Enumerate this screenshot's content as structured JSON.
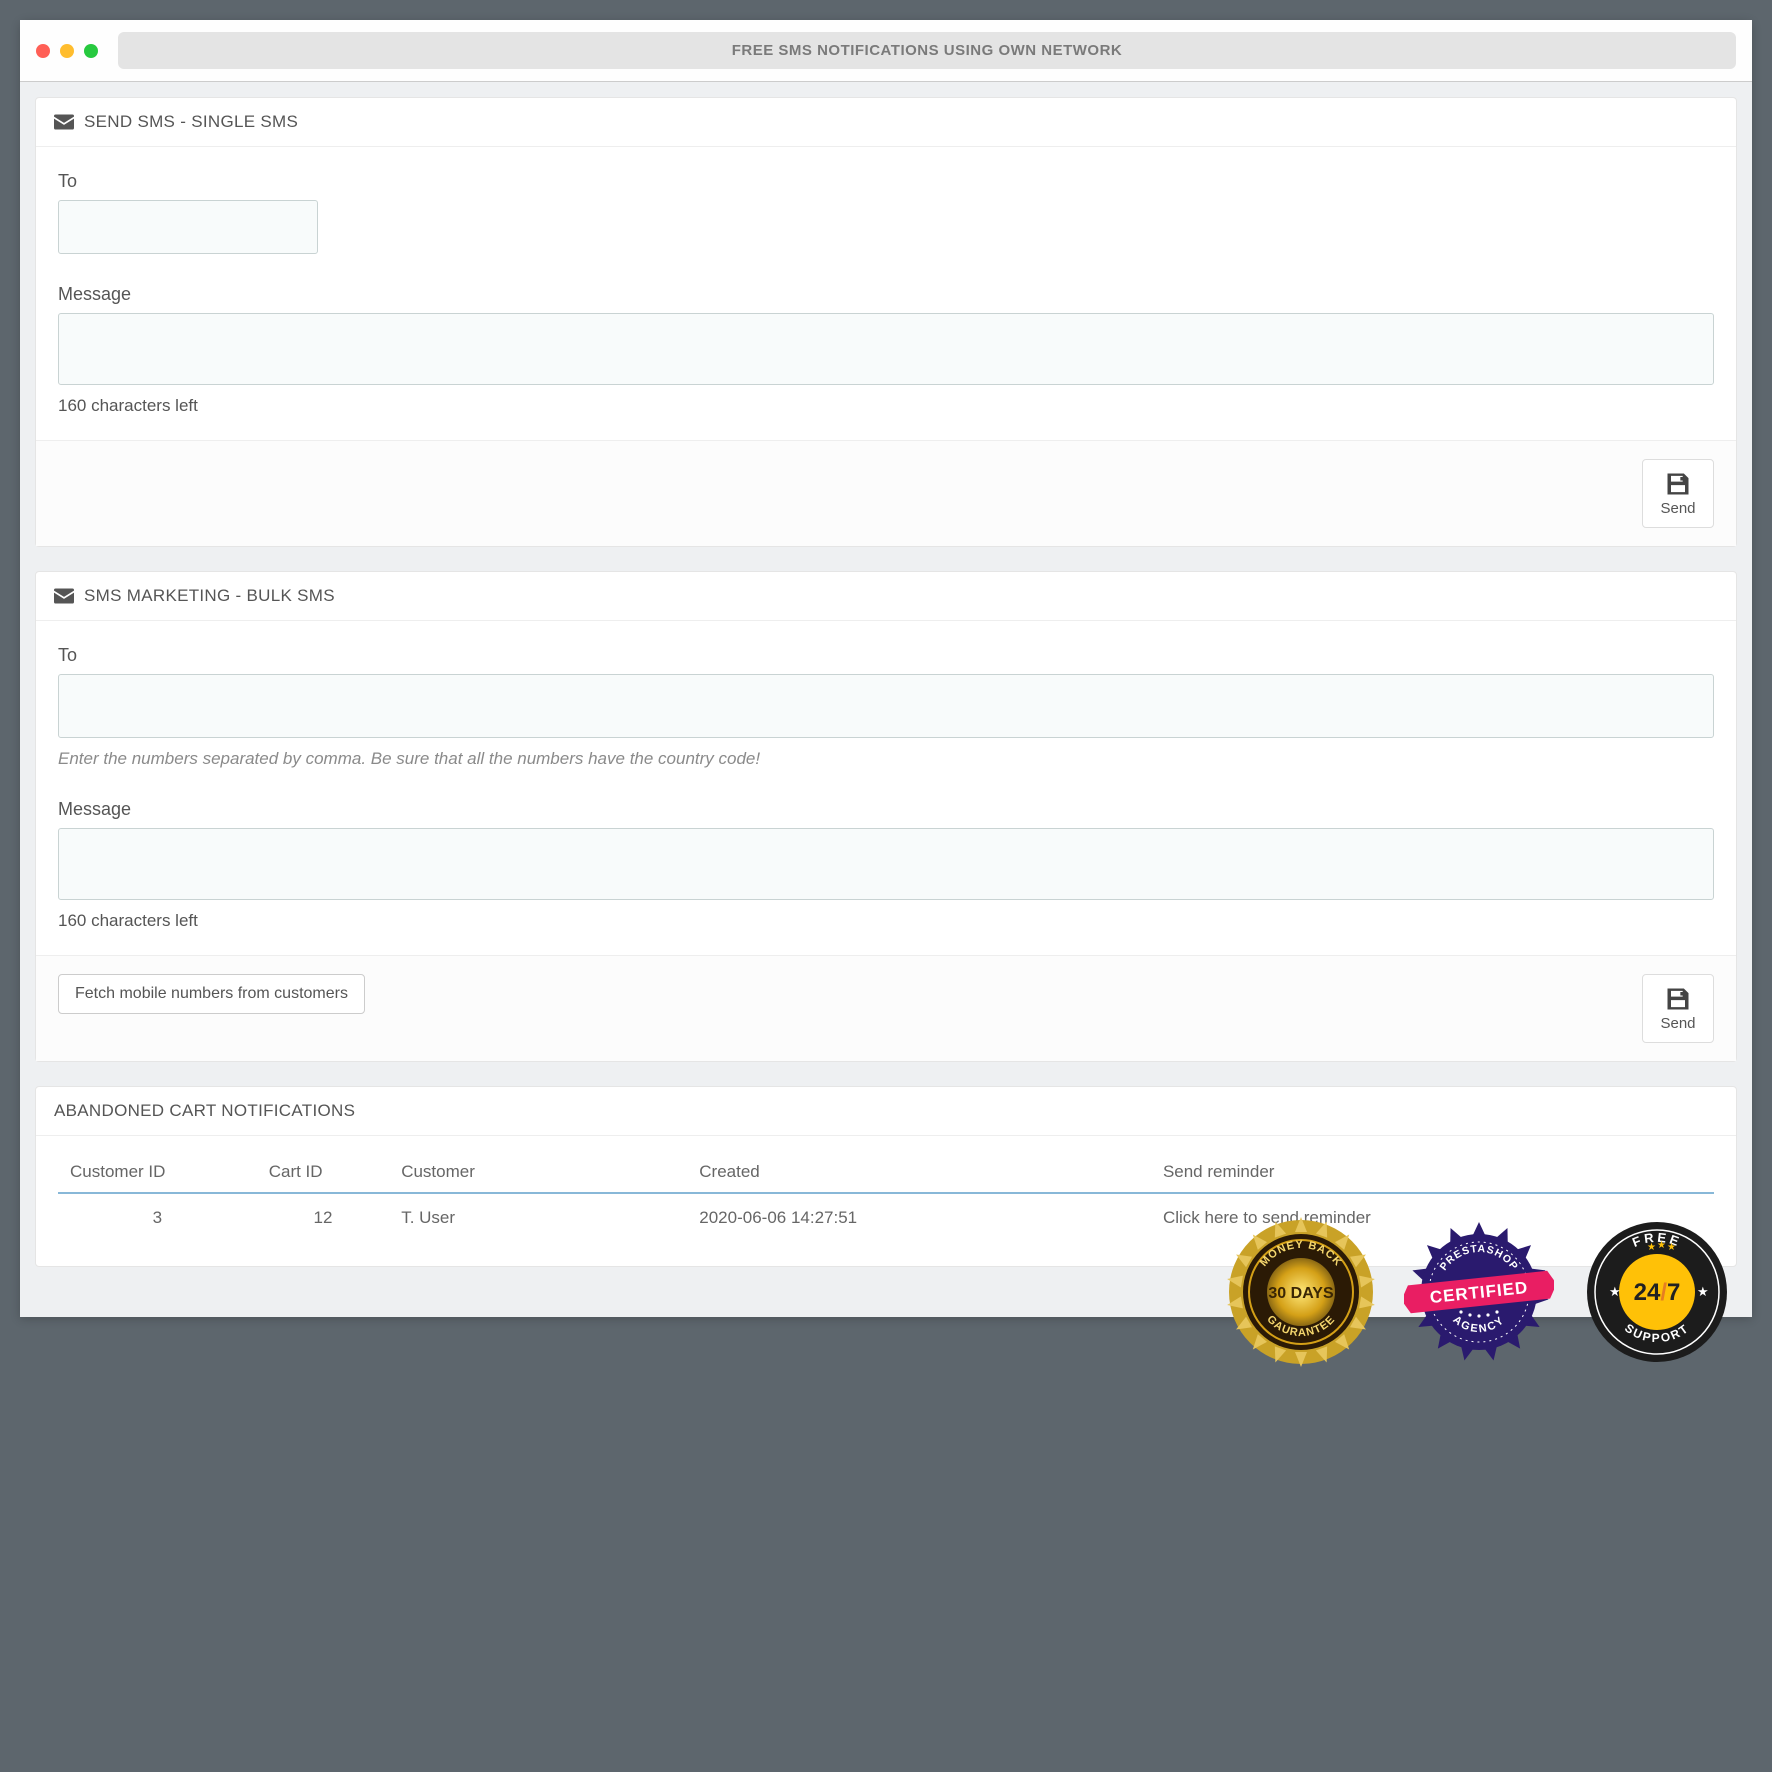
{
  "title": "FREE SMS NOTIFICATIONS USING OWN NETWORK",
  "single": {
    "header": "SEND SMS - SINGLE SMS",
    "to_label": "To",
    "msg_label": "Message",
    "counter": "160 characters left",
    "send": "Send"
  },
  "bulk": {
    "header": "SMS MARKETING - BULK SMS",
    "to_label": "To",
    "to_help": "Enter the numbers separated by comma. Be sure that all the numbers have the country code!",
    "msg_label": "Message",
    "counter": "160 characters left",
    "fetch": "Fetch mobile numbers from customers",
    "send": "Send"
  },
  "abandoned": {
    "header": "ABANDONED CART NOTIFICATIONS",
    "cols": {
      "cust_id": "Customer ID",
      "cart_id": "Cart ID",
      "customer": "Customer",
      "created": "Created",
      "send": "Send reminder"
    },
    "row": {
      "cust_id": "3",
      "cart_id": "12",
      "customer": "T. User",
      "created": "2020-06-06 14:27:51",
      "send": "Click here to send reminder"
    }
  },
  "badges": {
    "b1_top": "MONEY BACK",
    "b1_mid": "30 DAYS",
    "b1_bot": "GAURANTEE",
    "b2_top": "PRESTASHOP",
    "b2_mid": "CERTIFIED",
    "b2_bot": "AGENCY",
    "b3_top": "FREE",
    "b3_mid": "24/7",
    "b3_bot": "SUPPORT"
  }
}
